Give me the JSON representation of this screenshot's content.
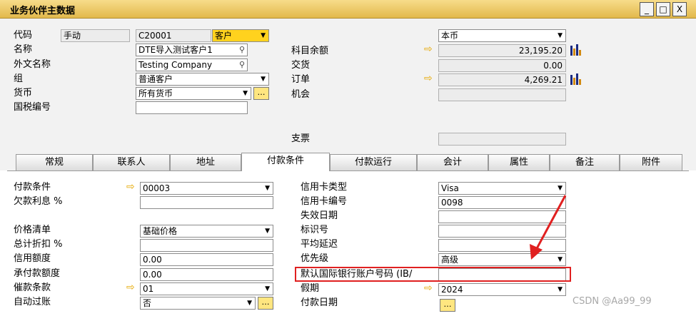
{
  "window": {
    "title": "业务伙伴主数据",
    "controls": {
      "minimize": "_",
      "restore": "□",
      "close": "X"
    }
  },
  "header": {
    "code_label": "代码",
    "code_mode": "手动",
    "code_value": "C20001",
    "bp_type": "客户",
    "name_label": "名称",
    "name_value": "DTE导入测试客户1",
    "foreign_name_label": "外文名称",
    "foreign_name_value": "Testing Company",
    "group_label": "组",
    "group_value": "普通客户",
    "currency_label": "货币",
    "currency_value": "所有货币",
    "tax_label": "国税编号",
    "tax_value": "",
    "local_currency": "本币",
    "account_balance_label": "科目余额",
    "account_balance_value": "23,195.20",
    "deliveries_label": "交货",
    "deliveries_value": "0.00",
    "orders_label": "订单",
    "orders_value": "4,269.21",
    "opportunities_label": "机会",
    "opportunities_value": "",
    "checks_label": "支票",
    "checks_value": ""
  },
  "tabs": [
    {
      "label": "常规"
    },
    {
      "label": "联系人"
    },
    {
      "label": "地址"
    },
    {
      "label": "付款条件",
      "active": true
    },
    {
      "label": "付款运行"
    },
    {
      "label": "会计"
    },
    {
      "label": "属性"
    },
    {
      "label": "备注"
    },
    {
      "label": "附件"
    }
  ],
  "payment": {
    "terms_label": "付款条件",
    "terms_value": "00003",
    "interest_label": "欠款利息 %",
    "interest_value": "",
    "price_list_label": "价格清单",
    "price_list_value": "基础价格",
    "discount_label": "总计折扣 %",
    "discount_value": "",
    "credit_limit_label": "信用额度",
    "credit_limit_value": "0.00",
    "commitment_limit_label": "承付款额度",
    "commitment_limit_value": "0.00",
    "dunning_label": "催款条款",
    "dunning_value": "01",
    "auto_post_label": "自动过账",
    "auto_post_value": "否",
    "card_type_label": "信用卡类型",
    "card_type_value": "Visa",
    "card_no_label": "信用卡编号",
    "card_no_value": "0098",
    "expiry_label": "失效日期",
    "expiry_value": "",
    "id_no_label": "标识号",
    "id_no_value": "",
    "avg_delay_label": "平均延迟",
    "avg_delay_value": "",
    "priority_label": "优先级",
    "priority_value": "高级",
    "iban_label": "默认国际银行账户号码 (IB/",
    "iban_value": "",
    "holidays_label": "假期",
    "holidays_value": "2024",
    "payment_dates_label": "付款日期"
  },
  "watermark": "CSDN @Aa99_99",
  "colors": {
    "titlebar": "#e8c25a",
    "required_field": "#ffd21e",
    "annotation": "#e02020",
    "link_arrow": "#e6a800"
  },
  "icons": {
    "link_arrow": "right-arrow-icon",
    "choose": "ellipsis-icon",
    "dropdown": "chevron-down-icon",
    "chart": "bar-chart-icon",
    "link": "link-icon"
  }
}
